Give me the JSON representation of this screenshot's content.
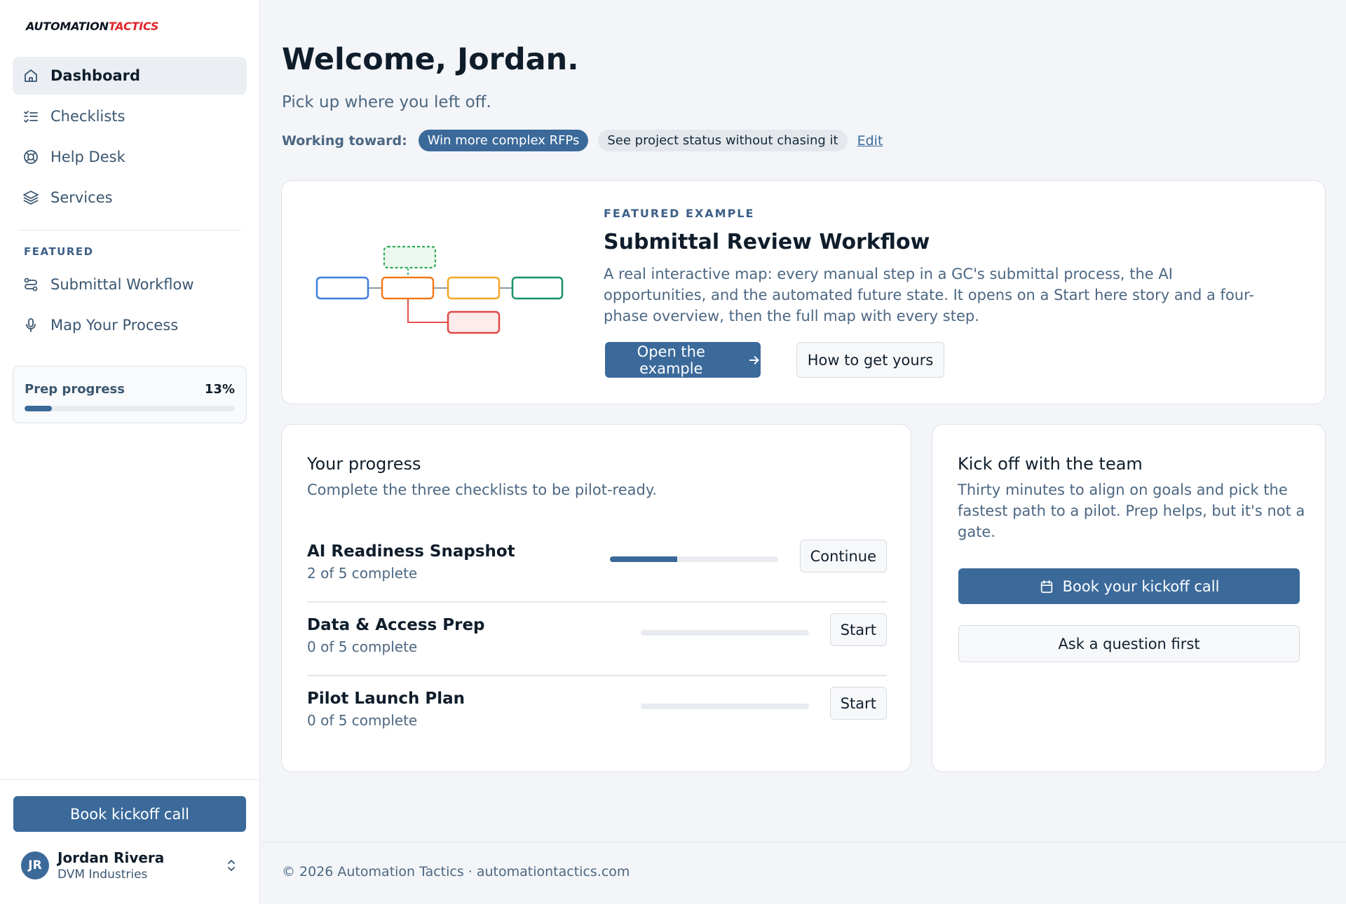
{
  "brand": {
    "part1": "AUTOMATION",
    "part2": "TACTICS"
  },
  "sidebar": {
    "items": [
      {
        "label": "Dashboard",
        "icon": "home-icon",
        "active": true
      },
      {
        "label": "Checklists",
        "icon": "list-check-icon"
      },
      {
        "label": "Help Desk",
        "icon": "lifebuoy-icon"
      },
      {
        "label": "Services",
        "icon": "layers-icon"
      }
    ],
    "featured_label": "FEATURED",
    "featured_items": [
      {
        "label": "Submittal Workflow",
        "icon": "workflow-icon"
      },
      {
        "label": "Map Your Process",
        "icon": "microphone-icon"
      }
    ],
    "prep": {
      "label": "Prep progress",
      "percent_text": "13%",
      "value": 0.13
    },
    "book_button": "Book kickoff call",
    "user": {
      "initials": "JR",
      "name": "Jordan Rivera",
      "org": "DVM Industries"
    }
  },
  "main": {
    "title": "Welcome, Jordan.",
    "subtitle": "Pick up where you left off.",
    "working_toward": {
      "label": "Working toward:",
      "chips": [
        {
          "label": "Win more complex RFPs",
          "selected": true
        },
        {
          "label": "See project status without chasing it",
          "selected": false
        }
      ],
      "edit": "Edit"
    },
    "featured": {
      "eyebrow": "FEATURED EXAMPLE",
      "title": "Submittal Review Workflow",
      "description": "A real interactive map: every manual step in a GC's submittal process, the AI opportunities, and the automated future state. It opens on a Start here story and a four-phase overview, then the full map with every step.",
      "open_button": "Open the example",
      "how_button": "How to get yours",
      "diagram_colors": [
        "#3b7ddd",
        "#f07a1a",
        "#f5a623",
        "#1a8f6a",
        "#e04848",
        "#2faa5a"
      ]
    },
    "progress": {
      "title": "Your progress",
      "subtitle": "Complete the three checklists to be pilot-ready.",
      "rows": [
        {
          "name": "AI Readiness Snapshot",
          "meta": "2 of 5 complete",
          "value": 0.4,
          "action": "Continue"
        },
        {
          "name": "Data & Access Prep",
          "meta": "0 of 5 complete",
          "value": 0,
          "action": "Start"
        },
        {
          "name": "Pilot Launch Plan",
          "meta": "0 of 5 complete",
          "value": 0,
          "action": "Start"
        }
      ]
    },
    "kickoff": {
      "title": "Kick off with the team",
      "subtitle": "Thirty minutes to align on goals and pick the fastest path to a pilot. Prep helps, but it's not a gate.",
      "book_button": "Book your kickoff call",
      "ask_button": "Ask a question first"
    },
    "footer": "© 2026 Automation Tactics · automationtactics.com"
  },
  "colors": {
    "accent": "#3b6a9a",
    "brand_red": "#e0262c"
  }
}
